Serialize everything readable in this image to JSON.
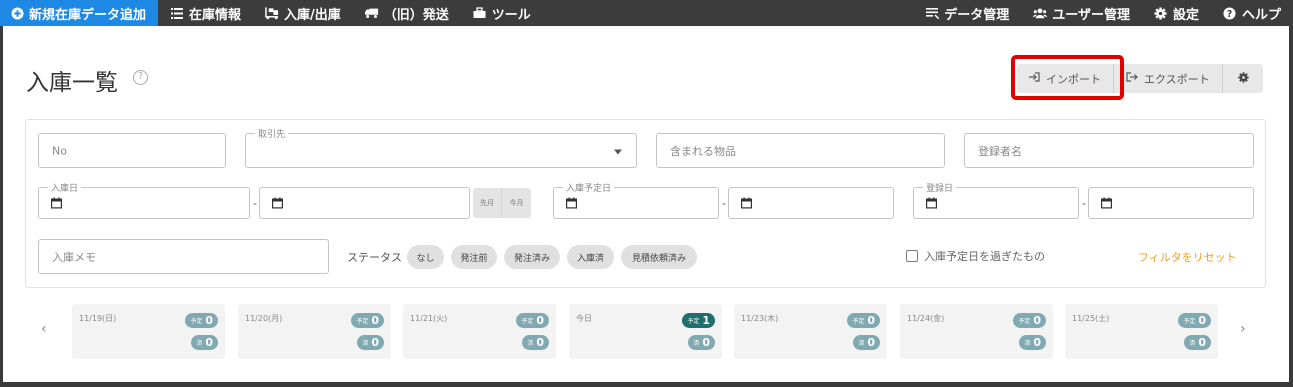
{
  "nav": {
    "items": [
      {
        "label": "新規在庫データ追加",
        "icon": "plus-circle-icon"
      },
      {
        "label": "在庫情報",
        "icon": "list-icon"
      },
      {
        "label": "入庫/出庫",
        "icon": "dolly-icon"
      },
      {
        "label": "（旧）発送",
        "icon": "truck-icon"
      },
      {
        "label": "ツール",
        "icon": "toolbox-icon"
      }
    ],
    "right_items": [
      {
        "label": "データ管理",
        "icon": "data-icon"
      },
      {
        "label": "ユーザー管理",
        "icon": "users-icon"
      },
      {
        "label": "設定",
        "icon": "gear-icon"
      },
      {
        "label": "ヘルプ",
        "icon": "help-icon"
      }
    ],
    "primary_color": "#1e88e5"
  },
  "page": {
    "title": "入庫一覧",
    "help_mark": "?"
  },
  "actions": {
    "import_label": "インポート",
    "export_label": "エクスポート"
  },
  "filters": {
    "no_placeholder": "No",
    "client_legend": "取引先",
    "items_placeholder": "含まれる物品",
    "registrant_placeholder": "登録者名",
    "receive_date_legend": "入庫日",
    "planned_date_legend": "入庫予定日",
    "registered_date_legend": "登録日",
    "range_dash": "-",
    "last_month": "先月",
    "this_month": "今月",
    "memo_placeholder": "入庫メモ",
    "status_label": "ステータス",
    "status_chips": [
      "なし",
      "発注前",
      "発注済み",
      "入庫済",
      "見積依頼済み"
    ],
    "overdue_label": "入庫予定日を過ぎたもの",
    "reset_label": "フィルタをリセット"
  },
  "calendar": {
    "prev": "‹",
    "next": "›",
    "plan_label": "予定",
    "done_label": "済",
    "days": [
      {
        "label": "11/19(日)",
        "plan": "0",
        "done": "0",
        "active": false
      },
      {
        "label": "11/20(月)",
        "plan": "0",
        "done": "0",
        "active": false
      },
      {
        "label": "11/21(火)",
        "plan": "0",
        "done": "0",
        "active": false
      },
      {
        "label": "今日",
        "plan": "1",
        "done": "0",
        "active": true
      },
      {
        "label": "11/23(木)",
        "plan": "0",
        "done": "0",
        "active": false
      },
      {
        "label": "11/24(金)",
        "plan": "0",
        "done": "0",
        "active": false
      },
      {
        "label": "11/25(土)",
        "plan": "0",
        "done": "0",
        "active": false
      }
    ]
  }
}
